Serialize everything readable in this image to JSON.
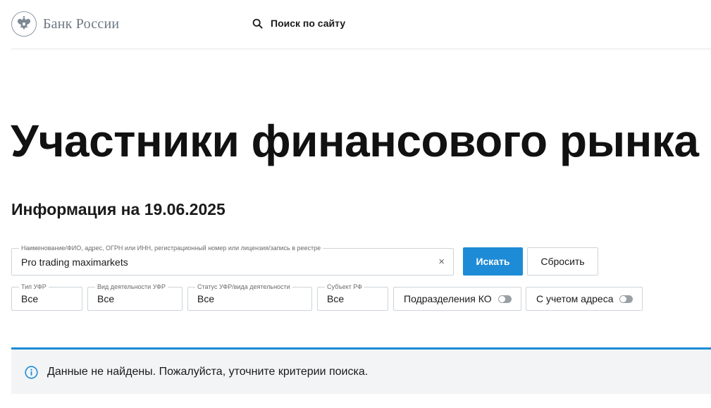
{
  "header": {
    "logo_text": "Банк России",
    "site_search_label": "Поиск по сайту"
  },
  "page": {
    "title": "Участники финансового рынка",
    "info_date": "Информация на 19.06.2025"
  },
  "search": {
    "main_field": {
      "legend": "Наименование/ФИО, адрес, ОГРН или ИНН, регистрационный номер или лицензия/запись в реестре",
      "value": "Pro trading maximarkets",
      "clear_glyph": "×"
    },
    "search_button": "Искать",
    "reset_button": "Сбросить"
  },
  "filters": {
    "type": {
      "legend": "Тип УФР",
      "value": "Все"
    },
    "activity": {
      "legend": "Вид деятельности УФР",
      "value": "Все"
    },
    "status": {
      "legend": "Статус УФР/вида деятельности",
      "value": "Все"
    },
    "region": {
      "legend": "Субъект РФ",
      "value": "Все"
    },
    "branches_toggle": {
      "label": "Подразделения КО",
      "on": false
    },
    "address_toggle": {
      "label": "С учетом адреса",
      "on": false
    }
  },
  "alert": {
    "text": "Данные не найдены. Пожалуйста, уточните критерии поиска."
  },
  "colors": {
    "accent": "#1e8bd6",
    "alert_bg": "#f2f4f5",
    "border": "#cfd4d9"
  },
  "icons": {
    "logo": "double-headed-eagle-emblem",
    "search": "search-icon",
    "info": "info-icon",
    "clear": "close-icon"
  }
}
